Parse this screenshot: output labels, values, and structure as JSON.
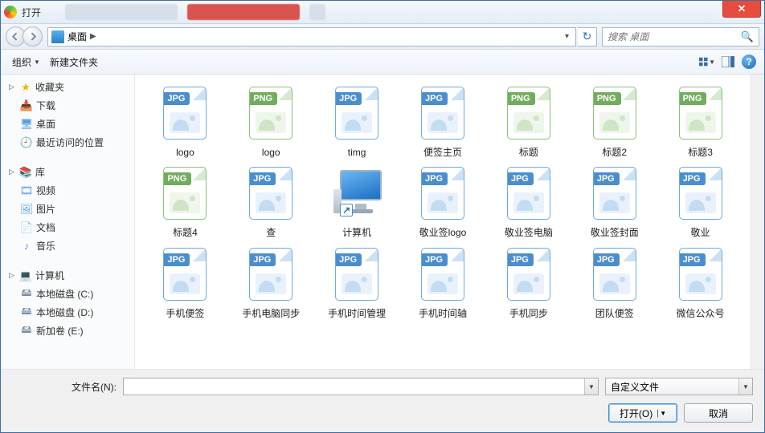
{
  "titlebar": {
    "title": "打开"
  },
  "nav": {
    "path_segment": "桌面",
    "search_placeholder": "搜索 桌面"
  },
  "toolbar": {
    "organize": "组织",
    "new_folder": "新建文件夹"
  },
  "sidebar": {
    "favorites": {
      "label": "收藏夹",
      "items": [
        "下载",
        "桌面",
        "最近访问的位置"
      ]
    },
    "libraries": {
      "label": "库",
      "items": [
        "视频",
        "图片",
        "文档",
        "音乐"
      ]
    },
    "computer": {
      "label": "计算机",
      "items": [
        "本地磁盘 (C:)",
        "本地磁盘 (D:)",
        "新加卷 (E:)"
      ]
    }
  },
  "files": [
    {
      "name": "logo",
      "type": "JPG"
    },
    {
      "name": "logo",
      "type": "PNG"
    },
    {
      "name": "timg",
      "type": "JPG"
    },
    {
      "name": "便签主页",
      "type": "JPG"
    },
    {
      "name": "标题",
      "type": "PNG"
    },
    {
      "name": "标题2",
      "type": "PNG"
    },
    {
      "name": "标题3",
      "type": "PNG"
    },
    {
      "name": "标题4",
      "type": "PNG"
    },
    {
      "name": "查",
      "type": "JPG"
    },
    {
      "name": "计算机",
      "type": "SHORTCUT"
    },
    {
      "name": "敬业签logo",
      "type": "JPG"
    },
    {
      "name": "敬业签电脑",
      "type": "JPG"
    },
    {
      "name": "敬业签封面",
      "type": "JPG"
    },
    {
      "name": "敬业",
      "type": "JPG"
    },
    {
      "name": "手机便签",
      "type": "JPG"
    },
    {
      "name": "手机电脑同步",
      "type": "JPG"
    },
    {
      "name": "手机时间管理",
      "type": "JPG"
    },
    {
      "name": "手机时间轴",
      "type": "JPG"
    },
    {
      "name": "手机同步",
      "type": "JPG"
    },
    {
      "name": "团队便签",
      "type": "JPG"
    },
    {
      "name": "微信公众号",
      "type": "JPG"
    }
  ],
  "footer": {
    "filename_label": "文件名(N):",
    "filetype": "自定义文件",
    "open": "打开(O)",
    "cancel": "取消"
  }
}
